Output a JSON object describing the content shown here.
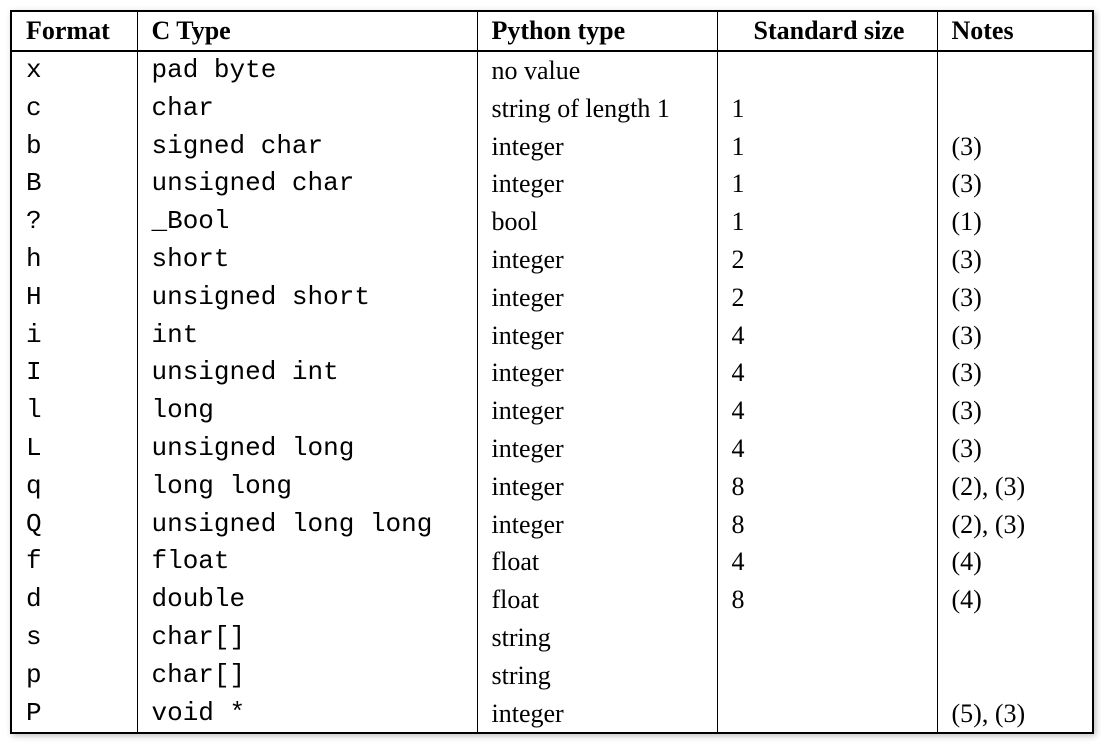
{
  "headers": {
    "format": "Format",
    "ctype": "C Type",
    "pytype": "Python type",
    "stdsize": "Standard size",
    "notes": "Notes"
  },
  "rows": [
    {
      "format": "x",
      "ctype": "pad byte",
      "pytype": "no value",
      "stdsize": "",
      "notes": ""
    },
    {
      "format": "c",
      "ctype": "char",
      "pytype": "string of length 1",
      "stdsize": "1",
      "notes": ""
    },
    {
      "format": "b",
      "ctype": "signed char",
      "pytype": "integer",
      "stdsize": "1",
      "notes": "(3)"
    },
    {
      "format": "B",
      "ctype": "unsigned char",
      "pytype": "integer",
      "stdsize": "1",
      "notes": "(3)"
    },
    {
      "format": "?",
      "ctype": "_Bool",
      "pytype": "bool",
      "stdsize": "1",
      "notes": "(1)"
    },
    {
      "format": "h",
      "ctype": "short",
      "pytype": "integer",
      "stdsize": "2",
      "notes": "(3)"
    },
    {
      "format": "H",
      "ctype": "unsigned short",
      "pytype": "integer",
      "stdsize": "2",
      "notes": "(3)"
    },
    {
      "format": "i",
      "ctype": "int",
      "pytype": "integer",
      "stdsize": "4",
      "notes": "(3)"
    },
    {
      "format": "I",
      "ctype": "unsigned int",
      "pytype": "integer",
      "stdsize": "4",
      "notes": "(3)"
    },
    {
      "format": "l",
      "ctype": "long",
      "pytype": "integer",
      "stdsize": "4",
      "notes": "(3)"
    },
    {
      "format": "L",
      "ctype": "unsigned long",
      "pytype": "integer",
      "stdsize": "4",
      "notes": "(3)"
    },
    {
      "format": "q",
      "ctype": "long long",
      "pytype": "integer",
      "stdsize": "8",
      "notes": "(2), (3)"
    },
    {
      "format": "Q",
      "ctype": "unsigned long long",
      "pytype": "integer",
      "stdsize": "8",
      "notes": "(2), (3)"
    },
    {
      "format": "f",
      "ctype": "float",
      "pytype": "float",
      "stdsize": "4",
      "notes": "(4)"
    },
    {
      "format": "d",
      "ctype": "double",
      "pytype": "float",
      "stdsize": "8",
      "notes": "(4)"
    },
    {
      "format": "s",
      "ctype": "char[]",
      "pytype": "string",
      "stdsize": "",
      "notes": ""
    },
    {
      "format": "p",
      "ctype": "char[]",
      "pytype": "string",
      "stdsize": "",
      "notes": ""
    },
    {
      "format": "P",
      "ctype": "void *",
      "pytype": "integer",
      "stdsize": "",
      "notes": "(5), (3)"
    }
  ]
}
